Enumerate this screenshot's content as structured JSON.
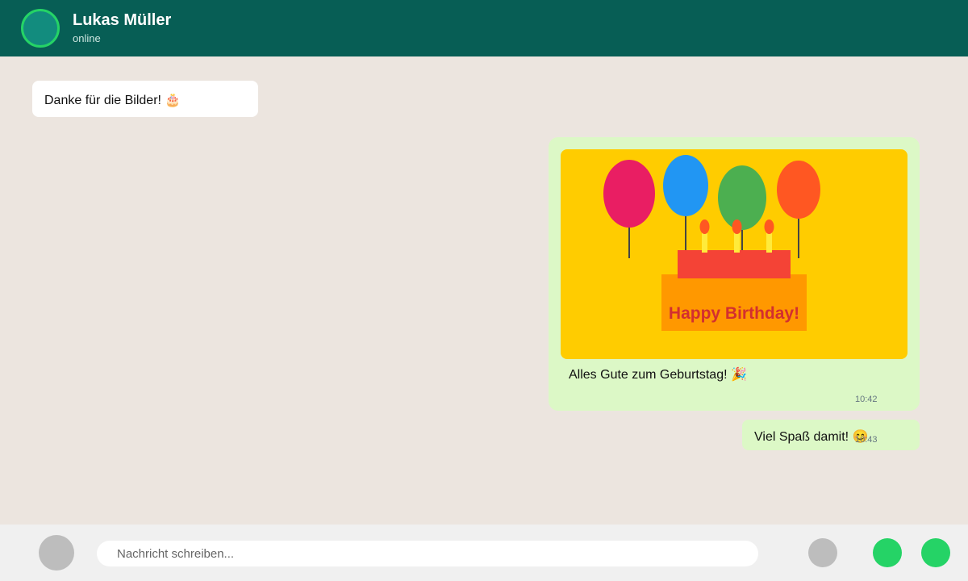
{
  "header": {
    "contact_name": "Lukas Müller",
    "status": "online"
  },
  "messages": [
    {
      "direction": "incoming",
      "text": "Danke für die Bilder! 🎂"
    },
    {
      "direction": "outgoing",
      "image": {
        "caption_on_image": "Happy Birthday!"
      },
      "text": "Alles Gute zum Geburtstag! 🎉",
      "time": "10:42"
    },
    {
      "direction": "outgoing",
      "text": "Viel Spaß damit! 😊",
      "time": "10:43"
    }
  ],
  "composer": {
    "placeholder": "Nachricht schreiben...",
    "icons": [
      "emoji-icon",
      "attach-icon",
      "mic-icon",
      "send-icon"
    ]
  },
  "colors": {
    "header": "#075e55",
    "chat_background": "#ece5df",
    "outgoing_bubble": "#dcf8c6",
    "incoming_bubble": "#ffffff",
    "accent": "#25d366"
  }
}
